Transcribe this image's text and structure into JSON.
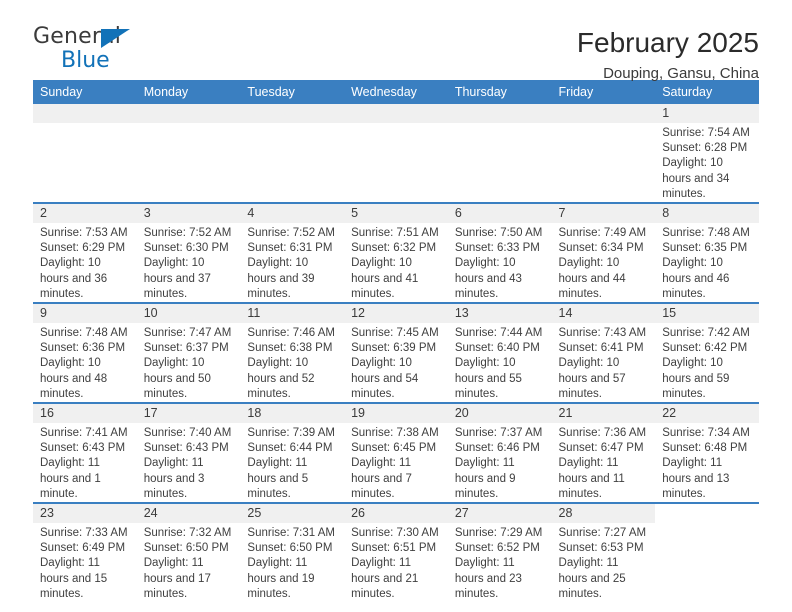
{
  "brand": {
    "name_top": "General",
    "name_bottom": "Blue",
    "accent_color": "#1272b8"
  },
  "header": {
    "title": "February 2025",
    "subtitle": "Douping, Gansu, China"
  },
  "theme": {
    "header_blue": "#3a7fc1",
    "daynum_band": "#f0f0f0",
    "text": "#404040"
  },
  "weekdays": [
    "Sunday",
    "Monday",
    "Tuesday",
    "Wednesday",
    "Thursday",
    "Friday",
    "Saturday"
  ],
  "labels": {
    "sunrise": "Sunrise:",
    "sunset": "Sunset:",
    "daylight": "Daylight:"
  },
  "weeks": [
    [
      {
        "day": "",
        "empty": true
      },
      {
        "day": "",
        "empty": true
      },
      {
        "day": "",
        "empty": true
      },
      {
        "day": "",
        "empty": true
      },
      {
        "day": "",
        "empty": true
      },
      {
        "day": "",
        "empty": true
      },
      {
        "day": "1",
        "sunrise": "Sunrise: 7:54 AM",
        "sunset": "Sunset: 6:28 PM",
        "daylight": "Daylight: 10 hours and 34 minutes."
      }
    ],
    [
      {
        "day": "2",
        "sunrise": "Sunrise: 7:53 AM",
        "sunset": "Sunset: 6:29 PM",
        "daylight": "Daylight: 10 hours and 36 minutes."
      },
      {
        "day": "3",
        "sunrise": "Sunrise: 7:52 AM",
        "sunset": "Sunset: 6:30 PM",
        "daylight": "Daylight: 10 hours and 37 minutes."
      },
      {
        "day": "4",
        "sunrise": "Sunrise: 7:52 AM",
        "sunset": "Sunset: 6:31 PM",
        "daylight": "Daylight: 10 hours and 39 minutes."
      },
      {
        "day": "5",
        "sunrise": "Sunrise: 7:51 AM",
        "sunset": "Sunset: 6:32 PM",
        "daylight": "Daylight: 10 hours and 41 minutes."
      },
      {
        "day": "6",
        "sunrise": "Sunrise: 7:50 AM",
        "sunset": "Sunset: 6:33 PM",
        "daylight": "Daylight: 10 hours and 43 minutes."
      },
      {
        "day": "7",
        "sunrise": "Sunrise: 7:49 AM",
        "sunset": "Sunset: 6:34 PM",
        "daylight": "Daylight: 10 hours and 44 minutes."
      },
      {
        "day": "8",
        "sunrise": "Sunrise: 7:48 AM",
        "sunset": "Sunset: 6:35 PM",
        "daylight": "Daylight: 10 hours and 46 minutes."
      }
    ],
    [
      {
        "day": "9",
        "sunrise": "Sunrise: 7:48 AM",
        "sunset": "Sunset: 6:36 PM",
        "daylight": "Daylight: 10 hours and 48 minutes."
      },
      {
        "day": "10",
        "sunrise": "Sunrise: 7:47 AM",
        "sunset": "Sunset: 6:37 PM",
        "daylight": "Daylight: 10 hours and 50 minutes."
      },
      {
        "day": "11",
        "sunrise": "Sunrise: 7:46 AM",
        "sunset": "Sunset: 6:38 PM",
        "daylight": "Daylight: 10 hours and 52 minutes."
      },
      {
        "day": "12",
        "sunrise": "Sunrise: 7:45 AM",
        "sunset": "Sunset: 6:39 PM",
        "daylight": "Daylight: 10 hours and 54 minutes."
      },
      {
        "day": "13",
        "sunrise": "Sunrise: 7:44 AM",
        "sunset": "Sunset: 6:40 PM",
        "daylight": "Daylight: 10 hours and 55 minutes."
      },
      {
        "day": "14",
        "sunrise": "Sunrise: 7:43 AM",
        "sunset": "Sunset: 6:41 PM",
        "daylight": "Daylight: 10 hours and 57 minutes."
      },
      {
        "day": "15",
        "sunrise": "Sunrise: 7:42 AM",
        "sunset": "Sunset: 6:42 PM",
        "daylight": "Daylight: 10 hours and 59 minutes."
      }
    ],
    [
      {
        "day": "16",
        "sunrise": "Sunrise: 7:41 AM",
        "sunset": "Sunset: 6:43 PM",
        "daylight": "Daylight: 11 hours and 1 minute."
      },
      {
        "day": "17",
        "sunrise": "Sunrise: 7:40 AM",
        "sunset": "Sunset: 6:43 PM",
        "daylight": "Daylight: 11 hours and 3 minutes."
      },
      {
        "day": "18",
        "sunrise": "Sunrise: 7:39 AM",
        "sunset": "Sunset: 6:44 PM",
        "daylight": "Daylight: 11 hours and 5 minutes."
      },
      {
        "day": "19",
        "sunrise": "Sunrise: 7:38 AM",
        "sunset": "Sunset: 6:45 PM",
        "daylight": "Daylight: 11 hours and 7 minutes."
      },
      {
        "day": "20",
        "sunrise": "Sunrise: 7:37 AM",
        "sunset": "Sunset: 6:46 PM",
        "daylight": "Daylight: 11 hours and 9 minutes."
      },
      {
        "day": "21",
        "sunrise": "Sunrise: 7:36 AM",
        "sunset": "Sunset: 6:47 PM",
        "daylight": "Daylight: 11 hours and 11 minutes."
      },
      {
        "day": "22",
        "sunrise": "Sunrise: 7:34 AM",
        "sunset": "Sunset: 6:48 PM",
        "daylight": "Daylight: 11 hours and 13 minutes."
      }
    ],
    [
      {
        "day": "23",
        "sunrise": "Sunrise: 7:33 AM",
        "sunset": "Sunset: 6:49 PM",
        "daylight": "Daylight: 11 hours and 15 minutes."
      },
      {
        "day": "24",
        "sunrise": "Sunrise: 7:32 AM",
        "sunset": "Sunset: 6:50 PM",
        "daylight": "Daylight: 11 hours and 17 minutes."
      },
      {
        "day": "25",
        "sunrise": "Sunrise: 7:31 AM",
        "sunset": "Sunset: 6:50 PM",
        "daylight": "Daylight: 11 hours and 19 minutes."
      },
      {
        "day": "26",
        "sunrise": "Sunrise: 7:30 AM",
        "sunset": "Sunset: 6:51 PM",
        "daylight": "Daylight: 11 hours and 21 minutes."
      },
      {
        "day": "27",
        "sunrise": "Sunrise: 7:29 AM",
        "sunset": "Sunset: 6:52 PM",
        "daylight": "Daylight: 11 hours and 23 minutes."
      },
      {
        "day": "28",
        "sunrise": "Sunrise: 7:27 AM",
        "sunset": "Sunset: 6:53 PM",
        "daylight": "Daylight: 11 hours and 25 minutes."
      },
      {
        "day": "",
        "blank": true
      }
    ]
  ]
}
